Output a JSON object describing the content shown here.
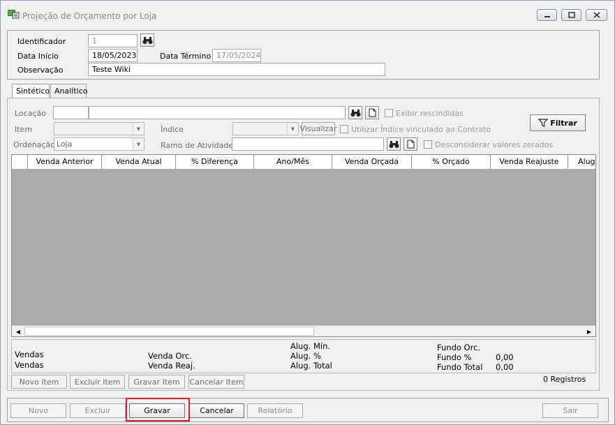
{
  "window": {
    "title": "Projeção de Orçamento por Loja",
    "controls": [
      "minimize",
      "maximize",
      "close"
    ]
  },
  "header": {
    "identificador_label": "Identificador",
    "identificador_value": "1",
    "data_inicio_label": "Data Início",
    "data_inicio_value": "18/05/2023",
    "data_termino_label": "Data Término",
    "data_termino_value": "17/05/2024",
    "observacao_label": "Observação",
    "observacao_value": "Teste Wiki"
  },
  "tabs": [
    "Sintético",
    "Analítico"
  ],
  "filters": {
    "locacao_label": "Locação",
    "locacao_code": "",
    "locacao_name": "",
    "exibir_rescindidas_label": "Exibir rescindidas",
    "item_label": "Item",
    "item_value": "",
    "indice_label": "Índice",
    "indice_value": "",
    "visualizar_label": "Visualizar",
    "utilizar_indice_label": "Utilizar Índice vinculado ao Contrato",
    "ordenacao_label": "Ordenação",
    "ordenacao_value": "Loja",
    "ramo_label": "Ramo de Atividade",
    "ramo_value": "",
    "desconsiderar_label": "Desconsiderar valores zerados",
    "filtrar_label": "Filtrar"
  },
  "grid": {
    "columns": [
      "",
      "Venda Anterior",
      "Venda Atual",
      "% Diferença",
      "Ano/Mês",
      "Venda Orçada",
      "% Orçado",
      "Venda Reajuste",
      "Alug"
    ],
    "rows": []
  },
  "summary": {
    "vendas_1": "Vendas",
    "vendas_2": "Vendas",
    "venda_orc": "Venda Orc.",
    "venda_reaj": "Venda Reaj.",
    "alug_min": "Alug. Mín.",
    "alug_pct": "Alug. %",
    "alug_total": "Alug. Total",
    "fundo_orc": "Fundo Orc.",
    "fundo_pct": "Fundo %",
    "fundo_pct_value": "0,00",
    "fundo_total": "Fundo Total",
    "fundo_total_value": "0,00"
  },
  "item_buttons": {
    "novo_item": "Novo Item",
    "excluir_item": "Excluir Item",
    "gravar_item": "Gravar Item",
    "cancelar_item": "Cancelar Item",
    "registros": "0 Registros"
  },
  "footer": {
    "novo": "Novo",
    "excluir": "Excluir",
    "gravar": "Gravar",
    "cancelar": "Cancelar",
    "relatorio": "Relatório",
    "sair": "Sair"
  },
  "colors": {
    "highlight": "#d62020",
    "grid_background": "#ababab",
    "window_background": "#f0f0f0"
  }
}
